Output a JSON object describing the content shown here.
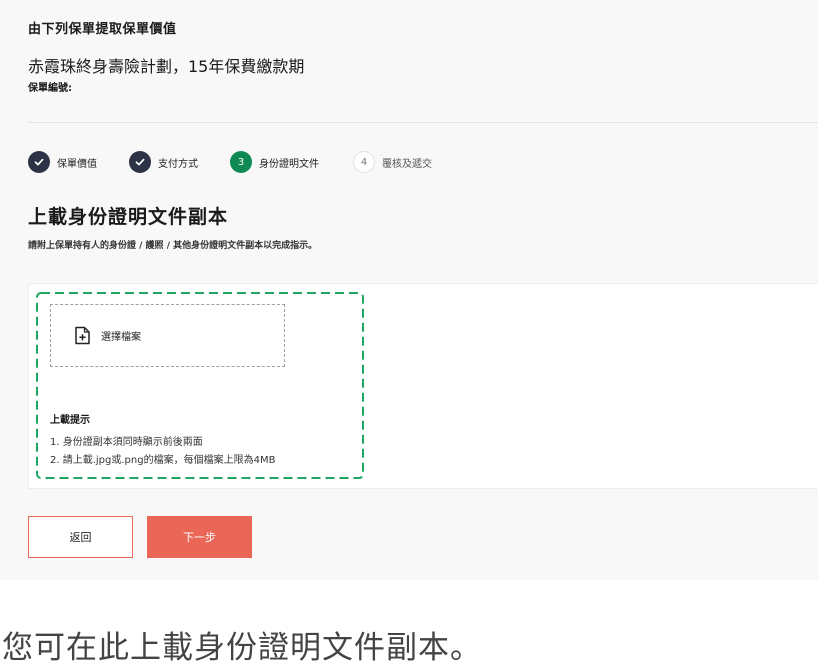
{
  "header": {
    "heading": "由下列保單提取保單價值",
    "plan_name": "赤霞珠終身壽險計劃，15年保費繳款期",
    "policy_no_label": "保單編號:"
  },
  "steps": [
    {
      "number": "",
      "label": "保單價值",
      "status": "done"
    },
    {
      "number": "",
      "label": "支付方式",
      "status": "done"
    },
    {
      "number": "3",
      "label": "身份證明文件",
      "status": "active"
    },
    {
      "number": "4",
      "label": "覆核及遞交",
      "status": "todo"
    }
  ],
  "upload": {
    "title": "上載身份證明文件副本",
    "description": "請附上保單持有人的身份證 / 護照 / 其他身份證明文件副本以完成指示。",
    "file_button_label": "選擇檔案",
    "hint_title": "上載提示",
    "hints": [
      "1. 身份證副本須同時顯示前後兩面",
      "2. 請上載.jpg或.png的檔案，每個檔案上限為4MB"
    ]
  },
  "buttons": {
    "back": "返回",
    "next": "下一步"
  },
  "caption": "您可在此上載身份證明文件副本。",
  "colors": {
    "accent": "#ea6757",
    "step_done": "#2c3347",
    "step_active": "#0f8a54",
    "dropzone_border": "#20a663"
  },
  "icons": {
    "step_done": "check-icon",
    "file": "file-add-icon"
  }
}
